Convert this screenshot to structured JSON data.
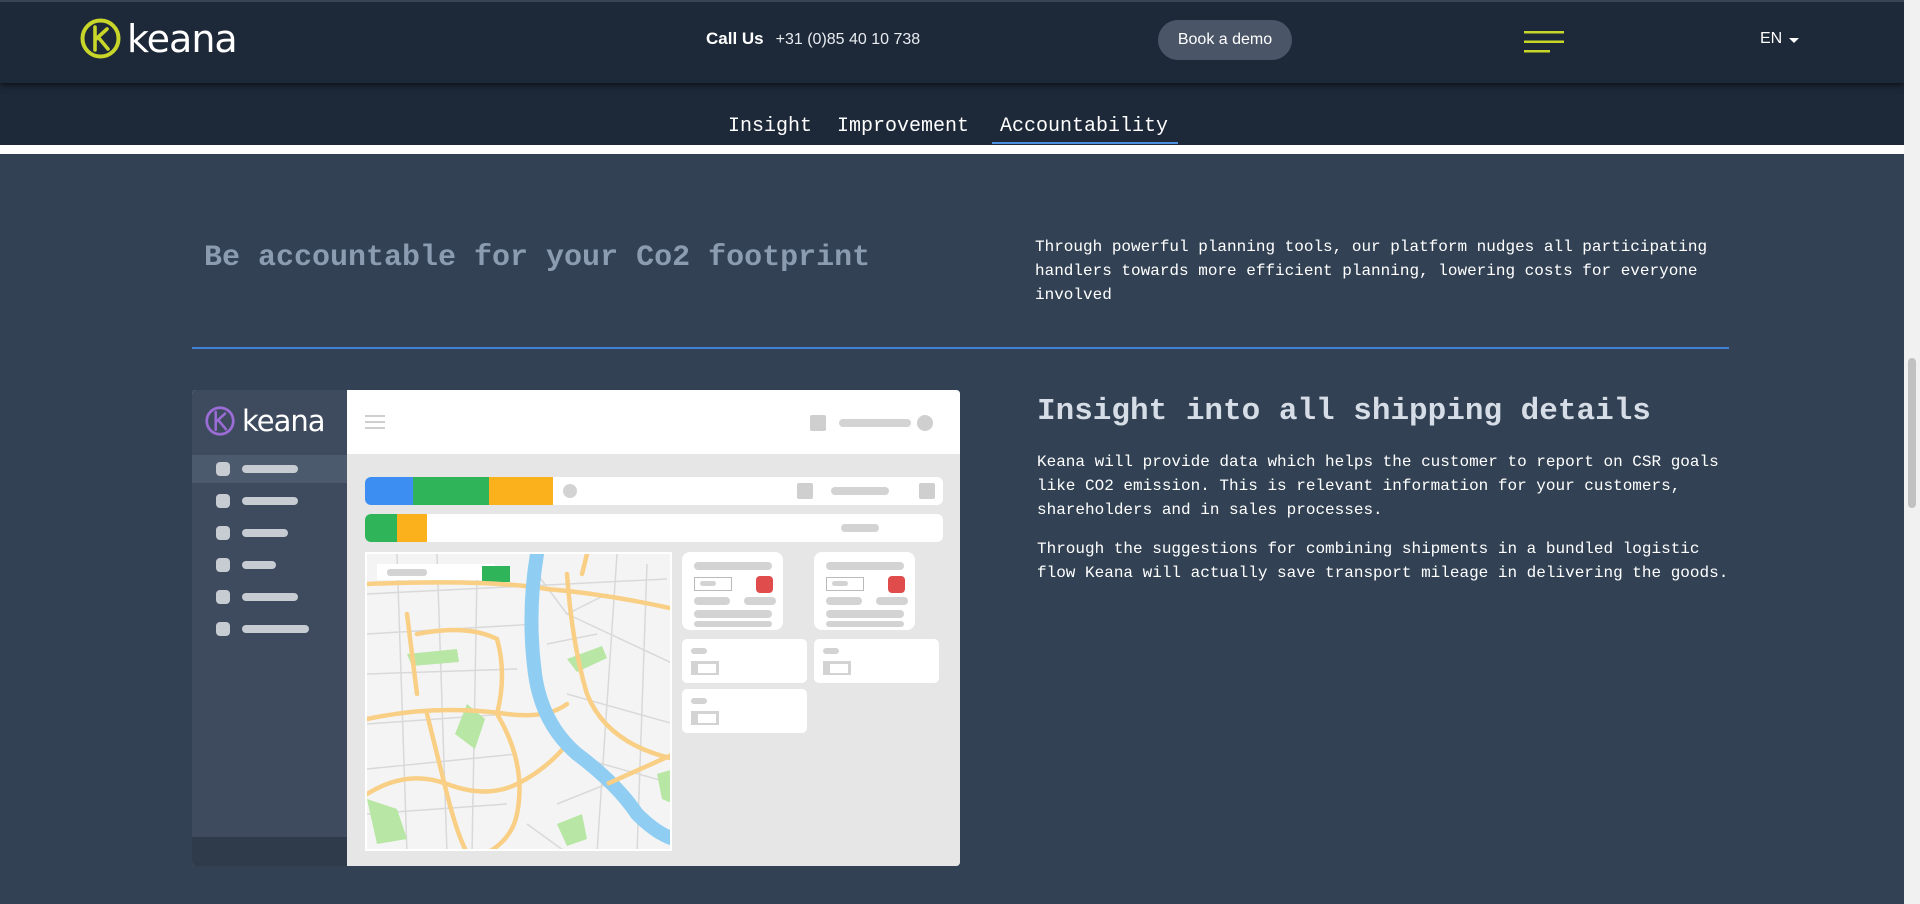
{
  "header": {
    "logo_text": "keana",
    "call_label": "Call Us",
    "phone": "+31 (0)85 40 10 738",
    "demo_button": "Book a demo",
    "menu_icon": "hamburger-menu-icon",
    "language": "EN"
  },
  "tabs": [
    {
      "label": "Insight",
      "active": false
    },
    {
      "label": "Improvement",
      "active": false
    },
    {
      "label": "Accountability",
      "active": true
    }
  ],
  "section": {
    "title": "Be accountable for your Co2 footprint",
    "description": "Through powerful planning tools, our platform nudges all participating handlers towards more efficient planning, lowering costs for everyone involved"
  },
  "insight": {
    "title": "Insight into all shipping details",
    "paragraphs": [
      "Keana will provide data which helps the customer to report on CSR goals like CO2 emission. This is relevant information for your customers, shareholders and in sales processes.",
      "Through the suggestions for combining shipments in a bundled logistic flow Keana will actually save transport mileage in delivering the goods."
    ]
  },
  "mockup": {
    "logo_text": "keana"
  },
  "colors": {
    "header_bg": "#1d2838",
    "page_bg": "#324254",
    "accent_green": "#c8d62a",
    "tab_underline": "#4c8fe0",
    "bar_blue": "#3d8ef2",
    "bar_green": "#2fb459",
    "bar_orange": "#fbb11c",
    "alert_red": "#e04b4b"
  }
}
